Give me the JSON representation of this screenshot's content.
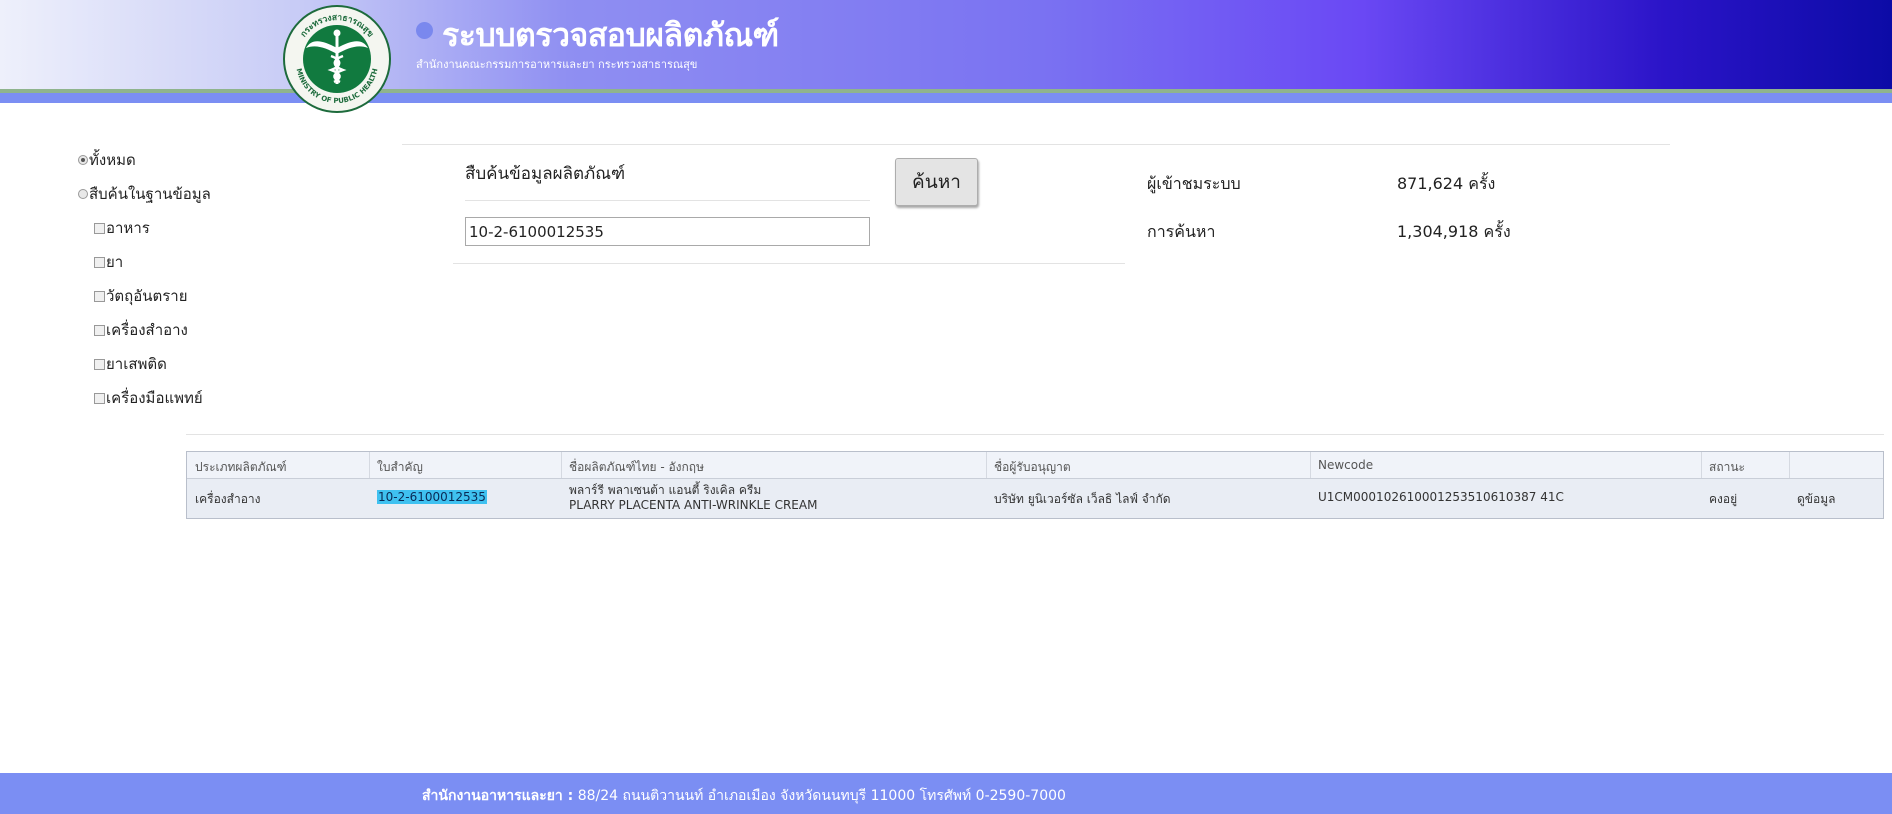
{
  "header": {
    "title": "ระบบตรวจสอบผลิตภัณฑ์",
    "subtitle": "สำนักงานคณะกรรมการอาหารและยา กระทรวงสาธารณสุข",
    "seal_text_top": "กระทรวงสาธารณสุข",
    "seal_text_bottom": "MINISTRY OF PUBLIC HEALTH"
  },
  "scope": {
    "all_label": "ทั้งหมด",
    "database_label": "สืบค้นในฐานข้อมูล",
    "selected": "all",
    "categories": [
      {
        "label": "อาหาร",
        "checked": false
      },
      {
        "label": "ยา",
        "checked": false
      },
      {
        "label": "วัตถุอันตราย",
        "checked": false
      },
      {
        "label": "เครื่องสำอาง",
        "checked": false
      },
      {
        "label": "ยาเสพติด",
        "checked": false
      },
      {
        "label": "เครื่องมือแพทย์",
        "checked": false
      }
    ]
  },
  "search": {
    "label": "สืบค้นข้อมูลผลิตภัณฑ์",
    "value": "10-2-6100012535",
    "button_label": "ค้นหา"
  },
  "stats": {
    "visitors_label": "ผู้เข้าชมระบบ",
    "visitors_value": "871,624 ครั้ง",
    "searches_label": "การค้นหา",
    "searches_value": "1,304,918 ครั้ง"
  },
  "results": {
    "columns": [
      "ประเภทผลิตภัณฑ์",
      "ใบสำคัญ",
      "ชื่อผลิตภัณฑ์ไทย - อังกฤษ",
      "ชื่อผู้รับอนุญาต",
      "Newcode",
      "สถานะ",
      ""
    ],
    "rows": [
      {
        "type": "เครื่องสำอาง",
        "license": "10-2-6100012535",
        "name_th": "พลาร์รี พลาเซนต้า แอนตี้ ริงเคิล ครีม",
        "name_en": "PLARRY PLACENTA ANTI-WRINKLE CREAM",
        "licensee": "บริษัท ยูนิเวอร์ซัล เว็ลธิ ไลฟ์ จำกัด",
        "newcode": "U1CM000102610001253510610387 41C",
        "status": "คงอยู่",
        "action": "ดูข้อมูล"
      }
    ]
  },
  "footer": {
    "org": "สำนักงานอาหารและยา :",
    "address": "88/24 ถนนติวานนท์ อำเภอเมือง จังหวัดนนทบุรี 11000 โทรศัพท์ 0-2590-7000"
  },
  "colors": {
    "header_gradient_start": "#eef0fb",
    "header_gradient_end": "#0c0ba6",
    "accent_blue": "#7b8ef3",
    "highlight": "#3fc1f0"
  }
}
